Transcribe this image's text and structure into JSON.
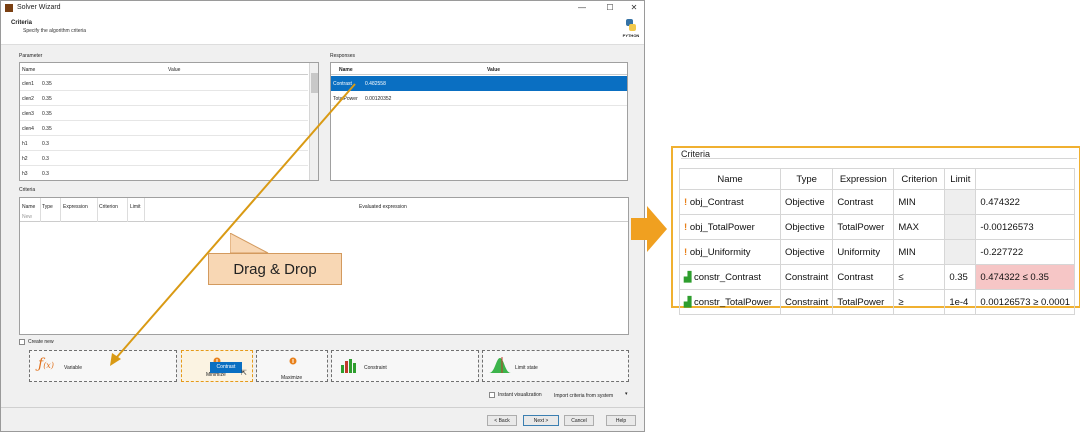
{
  "window": {
    "title": "Solver Wizard",
    "header_title": "Criteria",
    "header_subtitle": "Specify the algorithm criteria",
    "python_label": "PYTHON",
    "min_glyph": "—",
    "max_glyph": "☐",
    "close_glyph": "✕"
  },
  "parameter": {
    "label": "Parameter",
    "columns": [
      "Name",
      "Value"
    ],
    "rows": [
      {
        "name": "clen1",
        "value": "0.35"
      },
      {
        "name": "clen2",
        "value": "0.35"
      },
      {
        "name": "clen3",
        "value": "0.35"
      },
      {
        "name": "clen4",
        "value": "0.35"
      },
      {
        "name": "h1",
        "value": "0.3"
      },
      {
        "name": "h2",
        "value": "0.3"
      },
      {
        "name": "h3",
        "value": "0.3"
      }
    ]
  },
  "responses": {
    "label": "Responses",
    "columns": [
      "Name",
      "Value"
    ],
    "rows": [
      {
        "name": "Contrast",
        "value": "0.482558",
        "selected": true
      },
      {
        "name": "TotalPower",
        "value": "0.00120352",
        "selected": false
      }
    ]
  },
  "criteria": {
    "label": "Criteria",
    "columns": [
      "Name",
      "Type",
      "Expression",
      "Criterion",
      "Limit",
      "Evaluated expression"
    ],
    "new_row_placeholder": "New"
  },
  "create_new": {
    "label": "Create new",
    "tiles": [
      {
        "label": "Variable",
        "icon": "fx-icon"
      },
      {
        "label": "Minimize",
        "icon": "minimize-icon"
      },
      {
        "label": "Maximize",
        "icon": "maximize-icon"
      },
      {
        "label": "Constraint",
        "icon": "constraint-icon"
      },
      {
        "label": "Limit state",
        "icon": "limit-state-icon"
      }
    ],
    "drag_tooltip": "Contrast"
  },
  "options": {
    "instant_visualization": "Instant visualization",
    "import_criteria": "Import criteria from system"
  },
  "buttons": {
    "back": "< Back",
    "next": "Next >",
    "cancel": "Cancel",
    "help": "Help"
  },
  "callout": "Drag & Drop",
  "zoom_criteria": {
    "label": "Criteria",
    "columns": [
      "Name",
      "Type",
      "Expression",
      "Criterion",
      "Limit",
      ""
    ],
    "rows": [
      {
        "name": "obj_Contrast",
        "type": "Objective",
        "expression": "Contrast",
        "criterion": "MIN",
        "limit": "",
        "evaluated": "0.474322",
        "icon": "objective-icon",
        "highlight": false
      },
      {
        "name": "obj_TotalPower",
        "type": "Objective",
        "expression": "TotalPower",
        "criterion": "MAX",
        "limit": "",
        "evaluated": "-0.00126573",
        "icon": "objective-icon",
        "highlight": false
      },
      {
        "name": "obj_Uniformity",
        "type": "Objective",
        "expression": "Uniformity",
        "criterion": "MIN",
        "limit": "",
        "evaluated": "-0.227722",
        "icon": "objective-icon",
        "highlight": false
      },
      {
        "name": "constr_Contrast",
        "type": "Constraint",
        "expression": "Contrast",
        "criterion": "≤",
        "limit": "0.35",
        "evaluated": "0.474322 ≤ 0.35",
        "icon": "constraint-icon",
        "highlight": true
      },
      {
        "name": "constr_TotalPower",
        "type": "Constraint",
        "expression": "TotalPower",
        "criterion": "≥",
        "limit": "1e-4",
        "evaluated": "0.00126573 ≥ 0.0001",
        "icon": "constraint-icon",
        "highlight": false
      }
    ]
  },
  "colors": {
    "selection": "#0a6fc2",
    "arrow": "#d99a14",
    "highlight_cell": "#f6c6c6",
    "zoom_border": "#f0b030"
  }
}
